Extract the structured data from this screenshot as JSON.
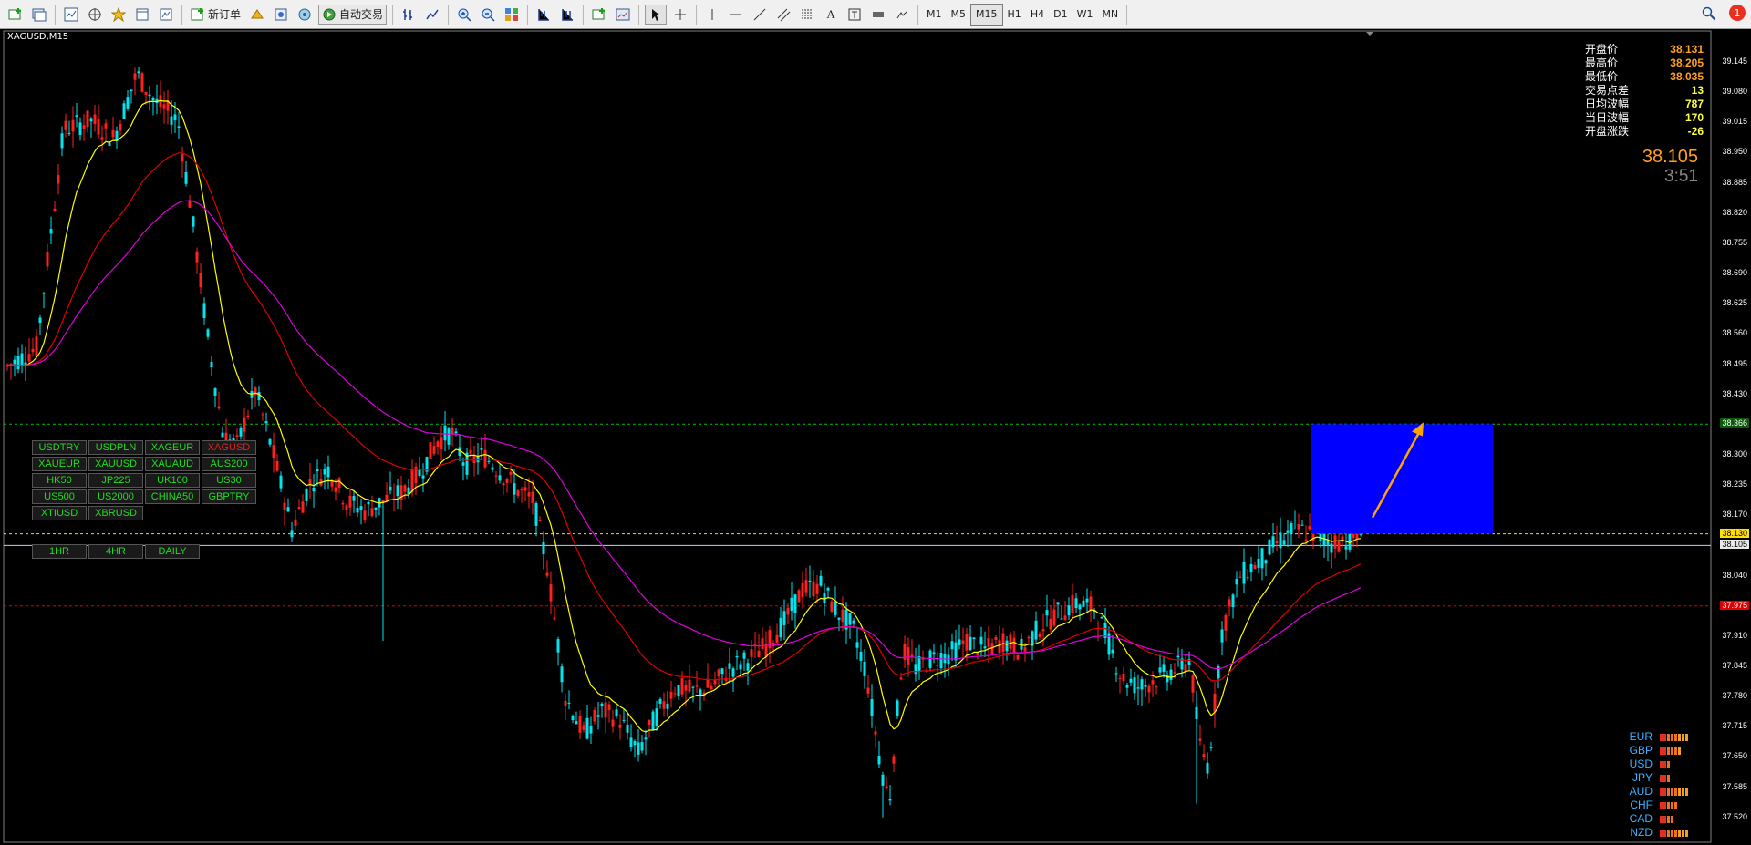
{
  "toolbar": {
    "new_order": "新订单",
    "auto_trade": "自动交易",
    "timeframes": [
      "M1",
      "M5",
      "M15",
      "H1",
      "H4",
      "D1",
      "W1",
      "MN"
    ],
    "active_timeframe": "M15",
    "alert_count": "1"
  },
  "chart": {
    "symbol_label": "XAGUSD,M15",
    "colors": {
      "bull": "#ff2020",
      "bear": "#00e5ee",
      "ma_fast": "#ffff00",
      "ma_mid": "#e00000",
      "ma_slow": "#dd00dd",
      "box": "#0000ff",
      "arrow": "#ffa500"
    }
  },
  "info_panel": {
    "rows": [
      {
        "label": "开盘价",
        "value": "38.131",
        "color": "#ffa020"
      },
      {
        "label": "最高价",
        "value": "38.205",
        "color": "#ffa020"
      },
      {
        "label": "最低价",
        "value": "38.035",
        "color": "#ffa020"
      },
      {
        "label": "交易点差",
        "value": "13",
        "color": "#ffff40"
      },
      {
        "label": "日均波幅",
        "value": "787",
        "color": "#ffff40"
      },
      {
        "label": "当日波幅",
        "value": "170",
        "color": "#ffff40"
      },
      {
        "label": "开盘涨跌",
        "value": "-26",
        "color": "#ffff40"
      }
    ],
    "current_price": "38.105",
    "countdown": "3:51"
  },
  "symbol_buttons": [
    "USDTRY",
    "USDPLN",
    "XAGEUR",
    "XAGUSD",
    "XAUEUR",
    "XAUUSD",
    "XAUAUD",
    "AUS200",
    "HK50",
    "JP225",
    "UK100",
    "US30",
    "US500",
    "US2000",
    "CHINA50",
    "GBPTRY",
    "XTIUSD",
    "XBRUSD"
  ],
  "selected_symbol": "XAGUSD",
  "period_buttons": [
    "1HR",
    "4HR",
    "DAILY"
  ],
  "strength": [
    {
      "name": "EUR",
      "bars": 8
    },
    {
      "name": "GBP",
      "bars": 6
    },
    {
      "name": "USD",
      "bars": 3
    },
    {
      "name": "JPY",
      "bars": 3
    },
    {
      "name": "AUD",
      "bars": 8
    },
    {
      "name": "CHF",
      "bars": 5
    },
    {
      "name": "CAD",
      "bars": 4
    },
    {
      "name": "NZD",
      "bars": 8
    }
  ],
  "price_axis": {
    "ticks": [
      "39.145",
      "39.080",
      "39.015",
      "38.950",
      "38.885",
      "38.820",
      "38.755",
      "38.690",
      "38.625",
      "38.560",
      "38.495",
      "38.430",
      "38.365",
      "38.300",
      "38.235",
      "38.170",
      "38.105",
      "38.040",
      "37.975",
      "37.910",
      "37.845",
      "37.780",
      "37.715",
      "37.650",
      "37.585",
      "37.520"
    ],
    "tag_green": "38.366",
    "tag_yellow": "38.130",
    "tag_white": "38.105",
    "tag_red": "37.975"
  }
}
